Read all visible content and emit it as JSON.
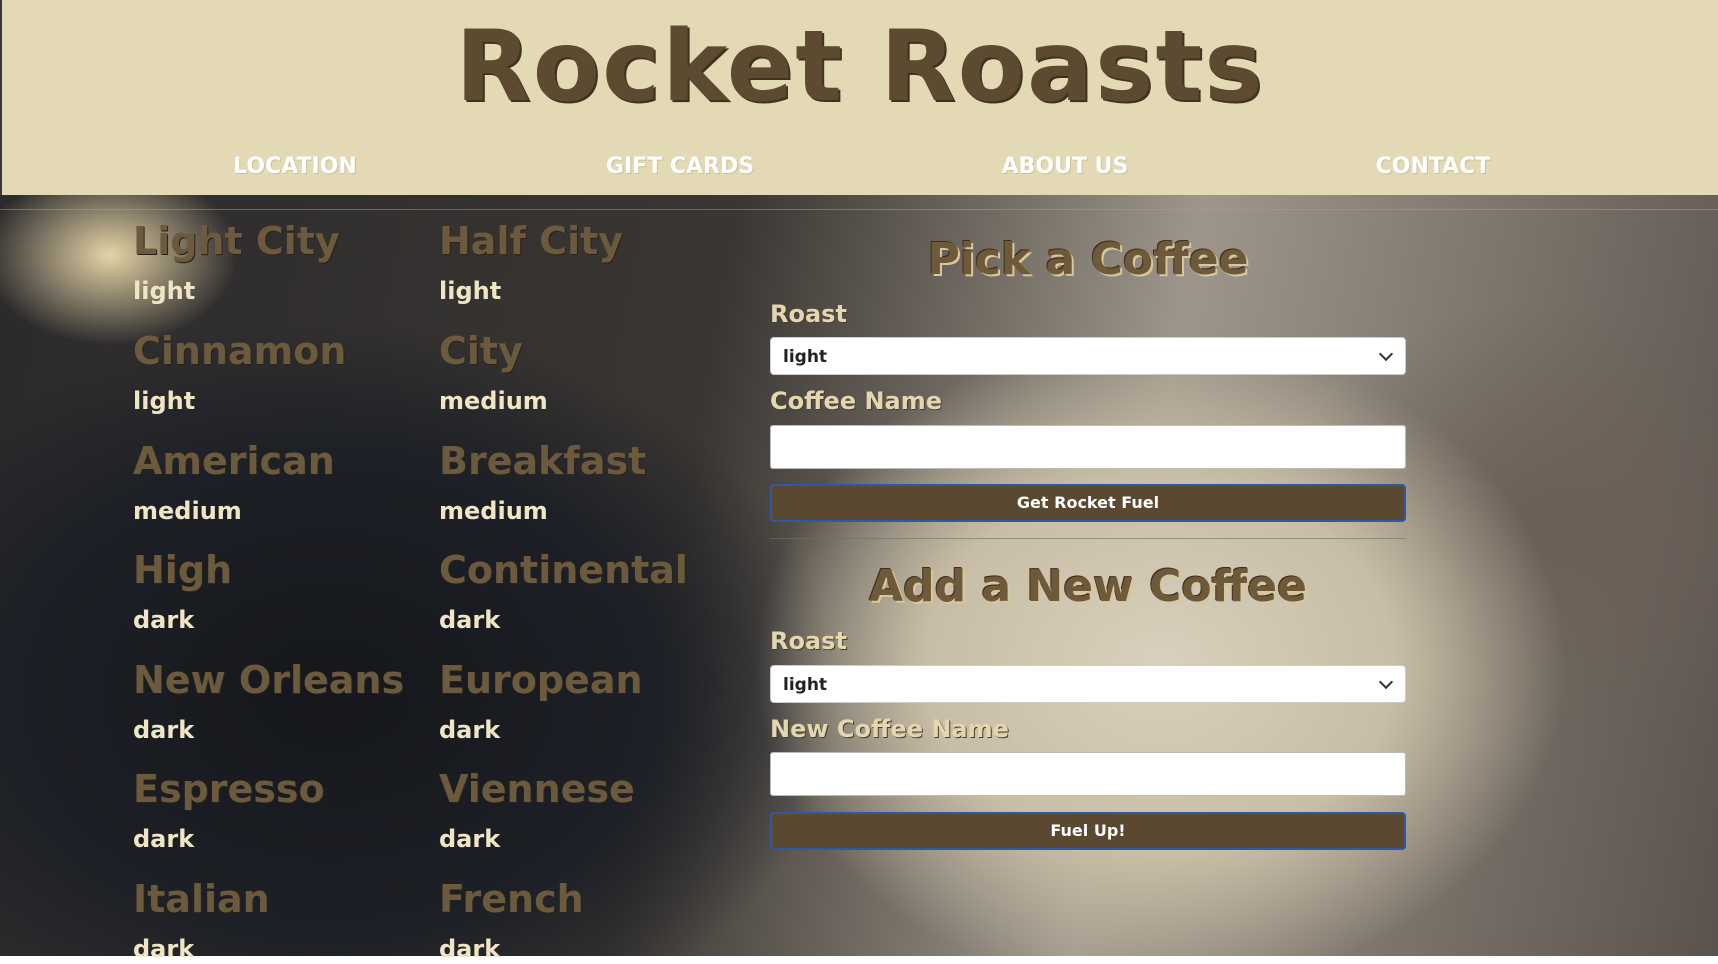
{
  "site": {
    "title": "Rocket Roasts"
  },
  "nav": [
    {
      "label": "LOCATION"
    },
    {
      "label": "GIFT CARDS"
    },
    {
      "label": "ABOUT US"
    },
    {
      "label": "CONTACT"
    }
  ],
  "coffees": [
    {
      "name": "Light City",
      "roast": "light"
    },
    {
      "name": "Half City",
      "roast": "light"
    },
    {
      "name": "Cinnamon",
      "roast": "light"
    },
    {
      "name": "City",
      "roast": "medium"
    },
    {
      "name": "American",
      "roast": "medium"
    },
    {
      "name": "Breakfast",
      "roast": "medium"
    },
    {
      "name": "High",
      "roast": "dark"
    },
    {
      "name": "Continental",
      "roast": "dark"
    },
    {
      "name": "New Orleans",
      "roast": "dark"
    },
    {
      "name": "European",
      "roast": "dark"
    },
    {
      "name": "Espresso",
      "roast": "dark"
    },
    {
      "name": "Viennese",
      "roast": "dark"
    },
    {
      "name": "Italian",
      "roast": "dark"
    },
    {
      "name": "French",
      "roast": "dark"
    }
  ],
  "pick_form": {
    "heading": "Pick a Coffee",
    "roast_label": "Roast",
    "roast_value": "light",
    "name_label": "Coffee Name",
    "name_value": "",
    "submit_label": "Get Rocket Fuel"
  },
  "add_form": {
    "heading": "Add a New Coffee",
    "roast_label": "Roast",
    "roast_value": "light",
    "name_label": "New Coffee Name",
    "name_value": "",
    "submit_label": "Fuel Up!"
  },
  "colors": {
    "header_bg": "#e3dab5",
    "brand_brown": "#5c4a31",
    "button_bg": "#5a4830",
    "button_border": "#2d5aa8"
  }
}
